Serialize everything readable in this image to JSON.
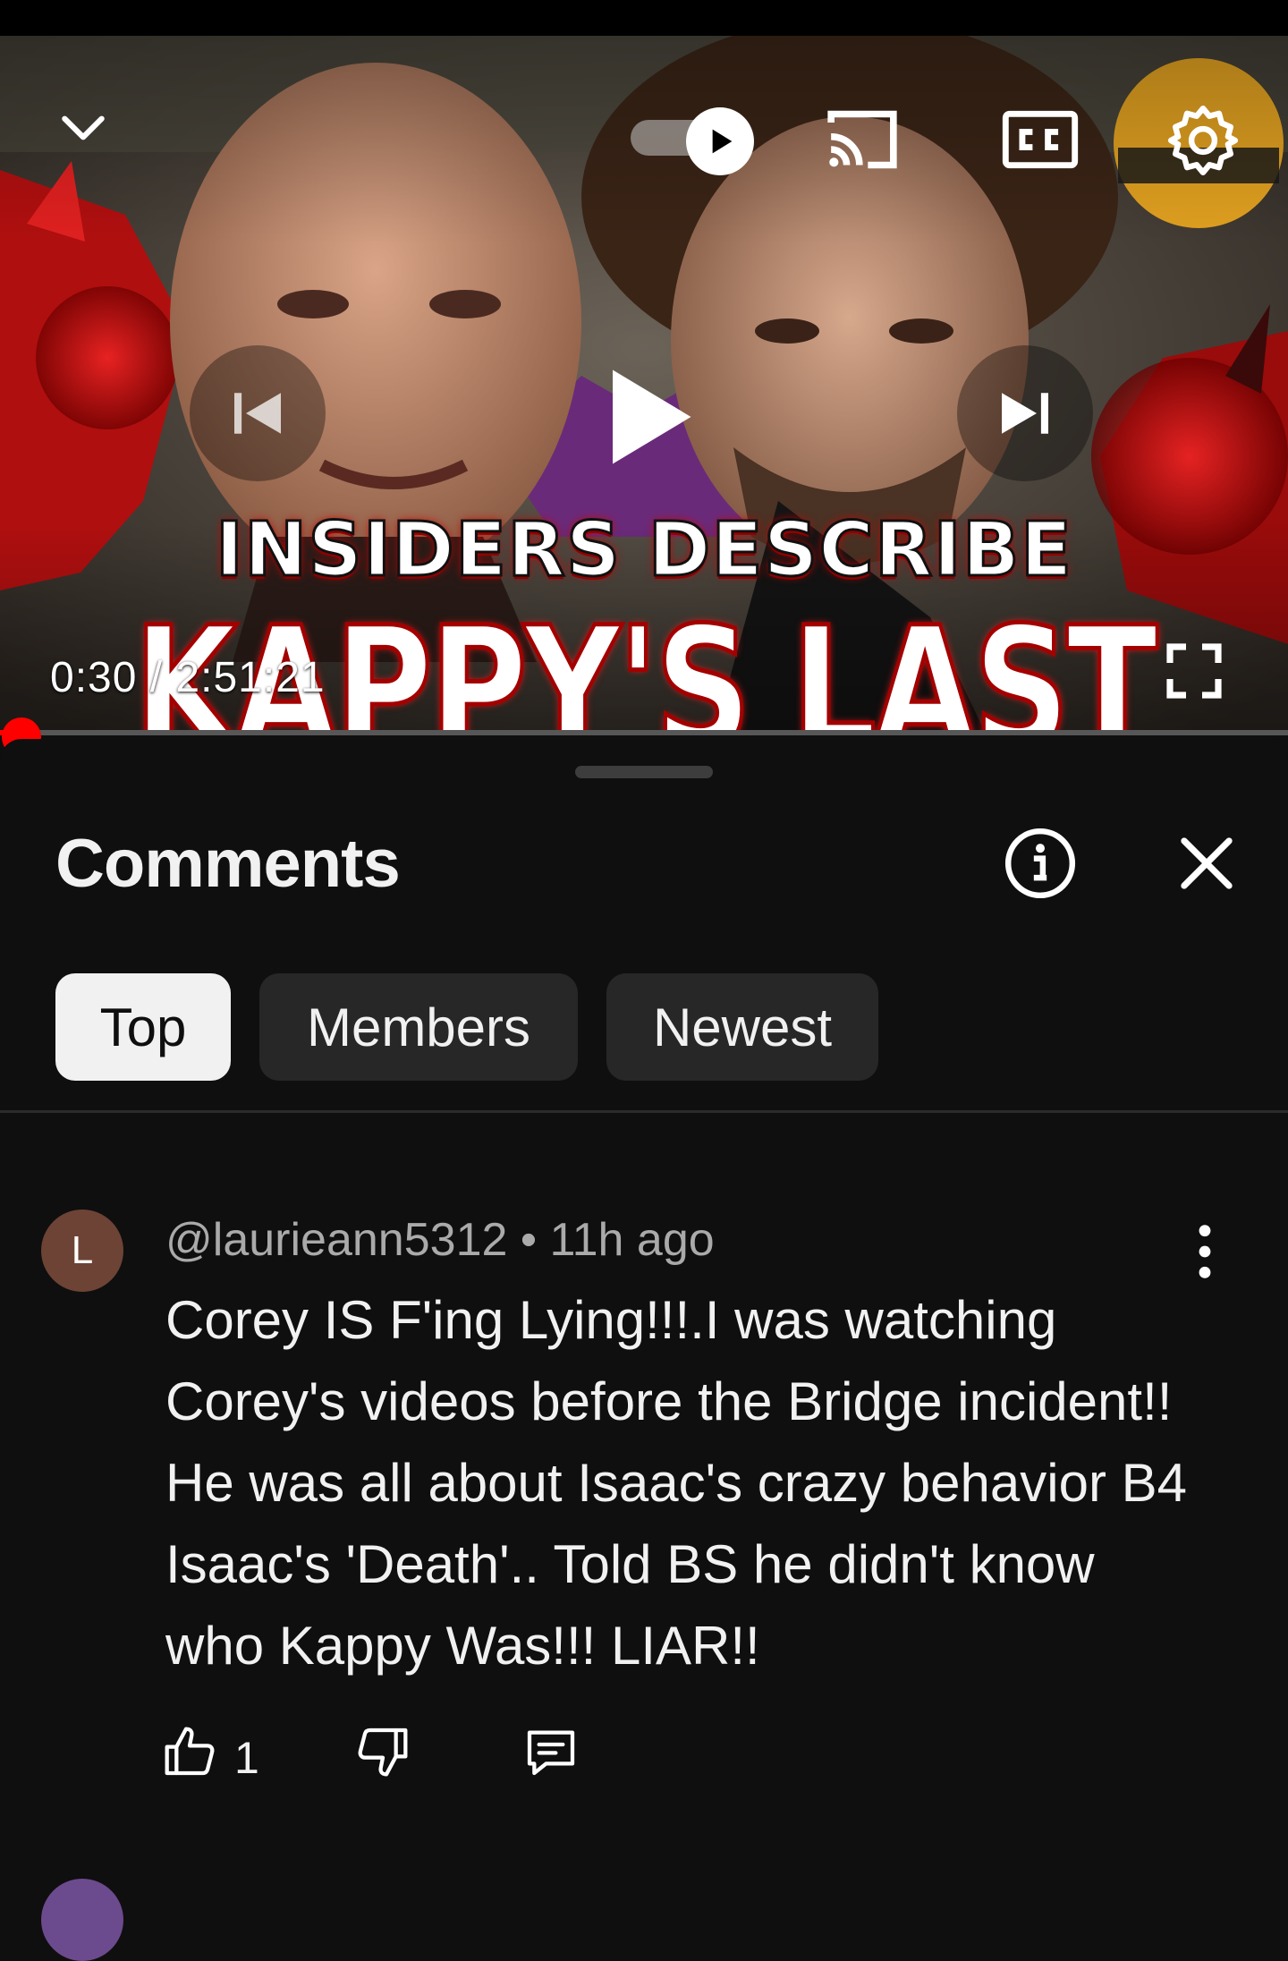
{
  "player": {
    "headline_line1": "INSIDERS DESCRIBE",
    "headline_line2": "KAPPY'S LAST DAYS!!",
    "time_current": "0:30",
    "time_total": "2:51:21",
    "time_display": "0:30 / 2:51:21",
    "progress_fraction": 0.003,
    "icons": [
      "chevron-down-icon",
      "autoplay-toggle-icon",
      "cast-icon",
      "closed-captions-icon",
      "settings-icon",
      "previous-icon",
      "play-icon",
      "next-icon",
      "fullscreen-icon"
    ]
  },
  "comments_panel": {
    "title": "Comments",
    "filters": [
      {
        "label": "Top",
        "selected": true
      },
      {
        "label": "Members",
        "selected": false
      },
      {
        "label": "Newest",
        "selected": false
      }
    ],
    "items": [
      {
        "avatar_letter": "L",
        "author": "@laurieann5312",
        "separator": "•",
        "time": "11h ago",
        "text": "Corey IS F'ing Lying!!!.I was watching Corey's videos before the Bridge incident!! He was all about Isaac's crazy behavior B4 Isaac's 'Death'.. Told BS he didn't know who Kappy Was!!! LIAR!!",
        "likes": "1"
      }
    ]
  },
  "colors": {
    "background": "#0f0f0f",
    "chip": "#272727",
    "chip_selected": "#f1f1f1",
    "text_primary": "#f1f1f1",
    "text_secondary": "#aaaaaa",
    "progress": "#ff0000",
    "avatar": "#6d4335"
  }
}
